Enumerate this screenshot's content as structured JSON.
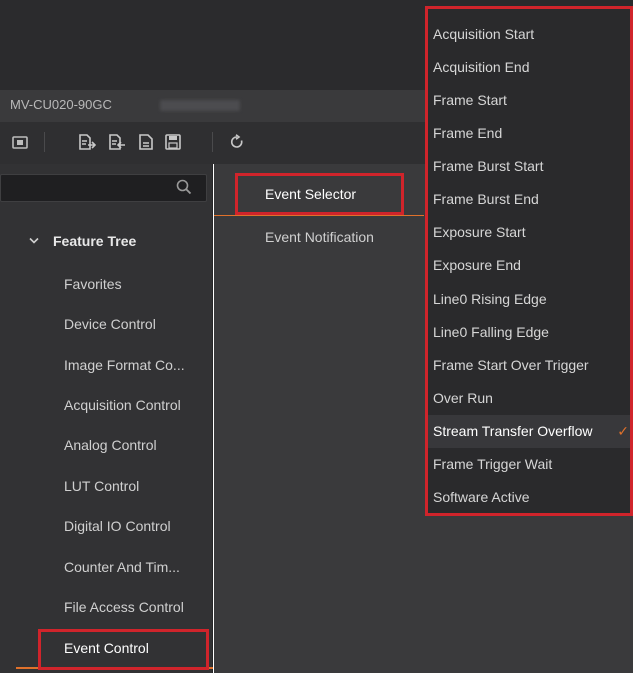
{
  "device": {
    "name": "MV-CU020-90GC"
  },
  "toolbar": {
    "icons": [
      "camera-icon",
      "export-features-icon",
      "import-features-icon",
      "document-icon",
      "save-icon",
      "refresh-icon"
    ]
  },
  "search": {
    "placeholder": ""
  },
  "feature_tree": {
    "header": "Feature Tree",
    "items": [
      "Favorites",
      "Device Control",
      "Image Format Co...",
      "Acquisition Control",
      "Analog Control",
      "LUT Control",
      "Digital IO Control",
      "Counter And Tim...",
      "File Access Control",
      "Event Control"
    ],
    "selected": "Event Control"
  },
  "properties": {
    "event_selector": "Event Selector",
    "event_notification": "Event Notification"
  },
  "dropdown": {
    "selected": "Stream Transfer Overflow",
    "options": [
      "Acquisition Start",
      "Acquisition End",
      "Frame Start",
      "Frame End",
      "Frame Burst Start",
      "Frame Burst End",
      "Exposure Start",
      "Exposure End",
      "Line0 Rising Edge",
      "Line0 Falling Edge",
      "Frame Start Over Trigger",
      "Over Run",
      "Stream Transfer Overflow",
      "Frame Trigger Wait",
      "Software Active"
    ]
  },
  "colors": {
    "accent": "#e0712b",
    "highlight_box": "#d0242b",
    "panel_bg": "#3a3a3c",
    "tree_bg": "#323234"
  }
}
